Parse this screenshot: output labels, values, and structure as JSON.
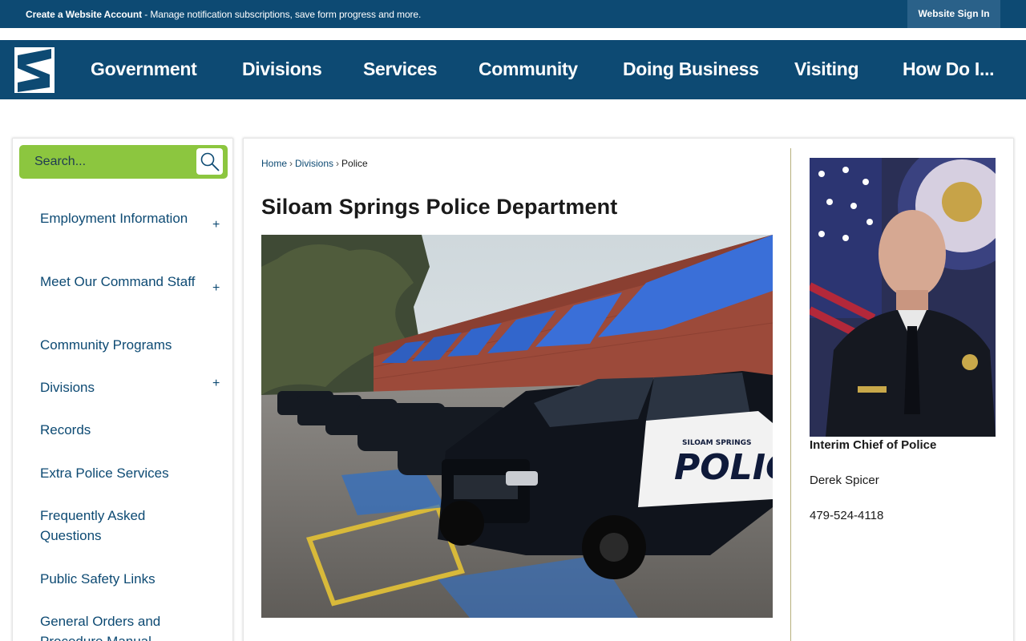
{
  "topbar": {
    "message_bold": "Create a Website Account",
    "message_rest": " - Manage notification subscriptions, save form progress and more.",
    "signin_label": "Website Sign In"
  },
  "nav": {
    "items": [
      {
        "label": "Government"
      },
      {
        "label": "Divisions"
      },
      {
        "label": "Services"
      },
      {
        "label": "Community"
      },
      {
        "label": "Doing Business"
      },
      {
        "label": "Visiting"
      },
      {
        "label": "How Do I..."
      }
    ]
  },
  "sidebar": {
    "search_placeholder": "Search...",
    "items": [
      {
        "label": "Employment Information",
        "expandable": true
      },
      {
        "label": "Meet Our Command Staff",
        "expandable": true
      },
      {
        "label": "Community Programs",
        "expandable": false
      },
      {
        "label": "Divisions",
        "expandable": true
      },
      {
        "label": "Records",
        "expandable": false
      },
      {
        "label": "Extra Police Services",
        "expandable": false
      },
      {
        "label": "Frequently Asked Questions",
        "expandable": false
      },
      {
        "label": "Public Safety Links",
        "expandable": false
      },
      {
        "label": "General Orders and Procedure Manual",
        "expandable": false
      }
    ],
    "expand_symbol": "+"
  },
  "breadcrumb": {
    "items": [
      "Home",
      "Divisions",
      "Police"
    ],
    "separator": "›"
  },
  "page": {
    "title": "Siloam Springs Police Department",
    "hero_vehicle_text": "POLICE",
    "hero_vehicle_subtext": "SILOAM SPRINGS"
  },
  "chief": {
    "role": "Interim Chief of Police",
    "name": "Derek Spicer",
    "phone": "479-524-4118"
  },
  "colors": {
    "brand_blue": "#0d4a73",
    "search_green": "#8cc63f",
    "divider": "#b7b07d"
  },
  "icons": {
    "search": "search-icon",
    "logo": "city-logo-icon"
  }
}
